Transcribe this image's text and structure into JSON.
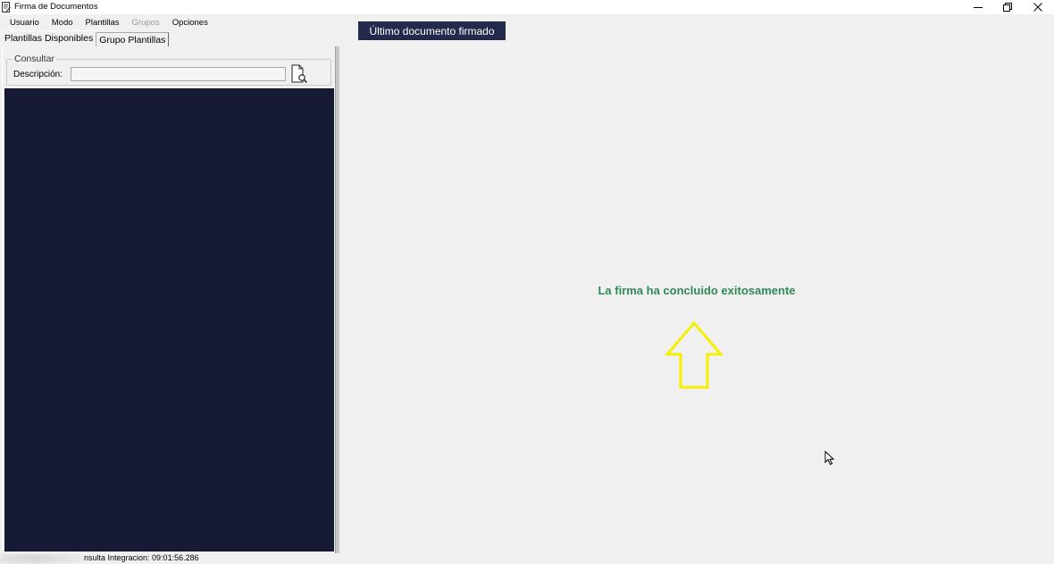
{
  "window": {
    "title": "Firma de Documentos",
    "controls": [
      "minimize",
      "restore",
      "close"
    ]
  },
  "menu": {
    "items": [
      {
        "label": "Usuario",
        "enabled": true
      },
      {
        "label": "Modo",
        "enabled": true
      },
      {
        "label": "Plantillas",
        "enabled": true
      },
      {
        "label": "Grupos",
        "enabled": false
      },
      {
        "label": "Opciones",
        "enabled": true
      }
    ]
  },
  "tabs": [
    {
      "label": "Plantillas Disponibles",
      "active": true
    },
    {
      "label": "Grupo Plantillas",
      "active": false
    }
  ],
  "search": {
    "group_title": "Consultar",
    "description_label": "Descripción:",
    "description_value": "",
    "button_icon": "document-search-icon"
  },
  "main": {
    "last_document_button": "Último documento firmado",
    "success_message": "La firma ha concluido exitosamente",
    "success_color": "#2e8b57",
    "arrow_icon": "up-arrow-outline-icon",
    "arrow_color": "#f5f000"
  },
  "status": {
    "text": "nsulta Integracion: 09:01:56.286"
  },
  "colors": {
    "list_background": "#161a35",
    "button_background": "#232a4c"
  }
}
